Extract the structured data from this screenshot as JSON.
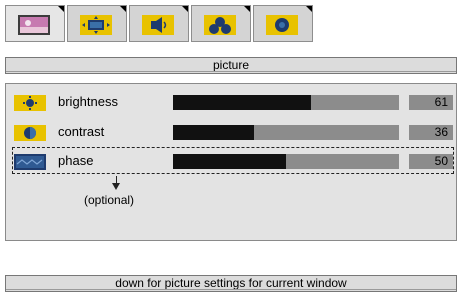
{
  "tabs": [
    {
      "icon": "picture-icon",
      "active": true
    },
    {
      "icon": "display-position-icon",
      "active": false
    },
    {
      "icon": "audio-icon",
      "active": false
    },
    {
      "icon": "color-icon",
      "active": false
    },
    {
      "icon": "settings-icon",
      "active": false
    }
  ],
  "header": {
    "title": "picture"
  },
  "settings": [
    {
      "label": "brightness",
      "value": "61",
      "level_percent": 61,
      "icon": "brightness-icon"
    },
    {
      "label": "contrast",
      "value": "36",
      "level_percent": 36,
      "icon": "contrast-icon"
    },
    {
      "label": "phase",
      "value": "50",
      "level_percent": 50,
      "icon": "phase-icon"
    }
  ],
  "annotation": {
    "optional": "(optional)"
  },
  "footer": {
    "hint": "down for picture settings for current window"
  },
  "colors": {
    "icon_bg": "#e8c200",
    "icon_dark": "#1e3b6e",
    "bar_fill": "#111111",
    "bar_track": "#8c8c8c",
    "panel_bg": "#e3e3e3"
  }
}
